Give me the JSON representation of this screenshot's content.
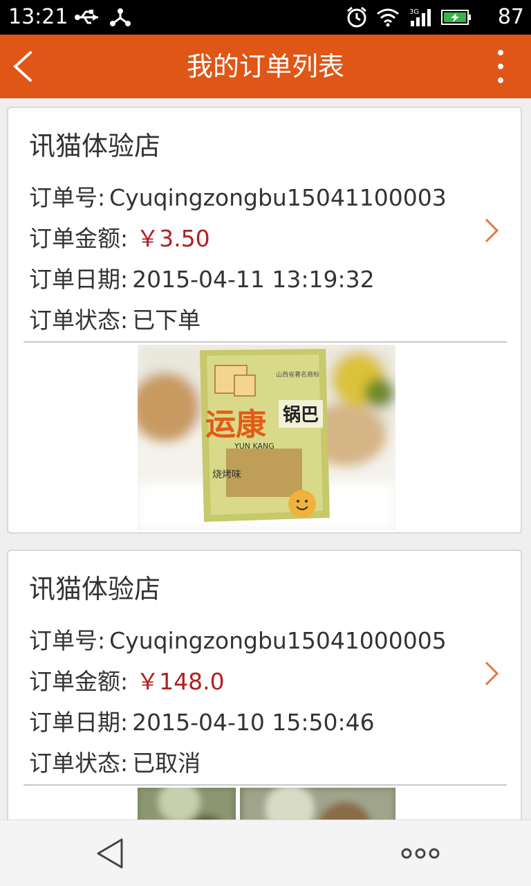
{
  "status_bar": {
    "time": "13:21",
    "battery": "87",
    "icons": [
      "usb-icon",
      "share-icon",
      "alarm-icon",
      "wifi-icon",
      "signal-3g-icon",
      "battery-charging-icon"
    ]
  },
  "app_bar": {
    "title": "我的订单列表",
    "back_icon": "chevron-left-icon",
    "menu_icon": "more-vertical-icon",
    "color": "#e05616"
  },
  "orders": [
    {
      "store": "讯猫体验店",
      "order_no_label": "订单号:",
      "order_no": "Cyuqingzongbu15041100003",
      "amount_label": "订单金额:",
      "amount": "￥3.50",
      "date_label": "订单日期:",
      "date": "2015-04-11 13:19:32",
      "status_label": "订单状态:",
      "status": "已下单",
      "image_text": {
        "brand": "运康",
        "product": "锅巴",
        "flavor": "烧烤味",
        "origin": "山西省著名商标",
        "pinyin": "YUN KANG"
      }
    },
    {
      "store": "讯猫体验店",
      "order_no_label": "订单号:",
      "order_no": "Cyuqingzongbu15041000005",
      "amount_label": "订单金额:",
      "amount": "￥148.0",
      "date_label": "订单日期:",
      "date": "2015-04-10 15:50:46",
      "status_label": "订单状态:",
      "status": "已取消"
    }
  ],
  "colors": {
    "price": "#b0201f",
    "arrow": "#e8743b"
  },
  "nav_bar": {
    "back_icon": "triangle-back-icon",
    "menu_icon": "three-dots-icon"
  }
}
